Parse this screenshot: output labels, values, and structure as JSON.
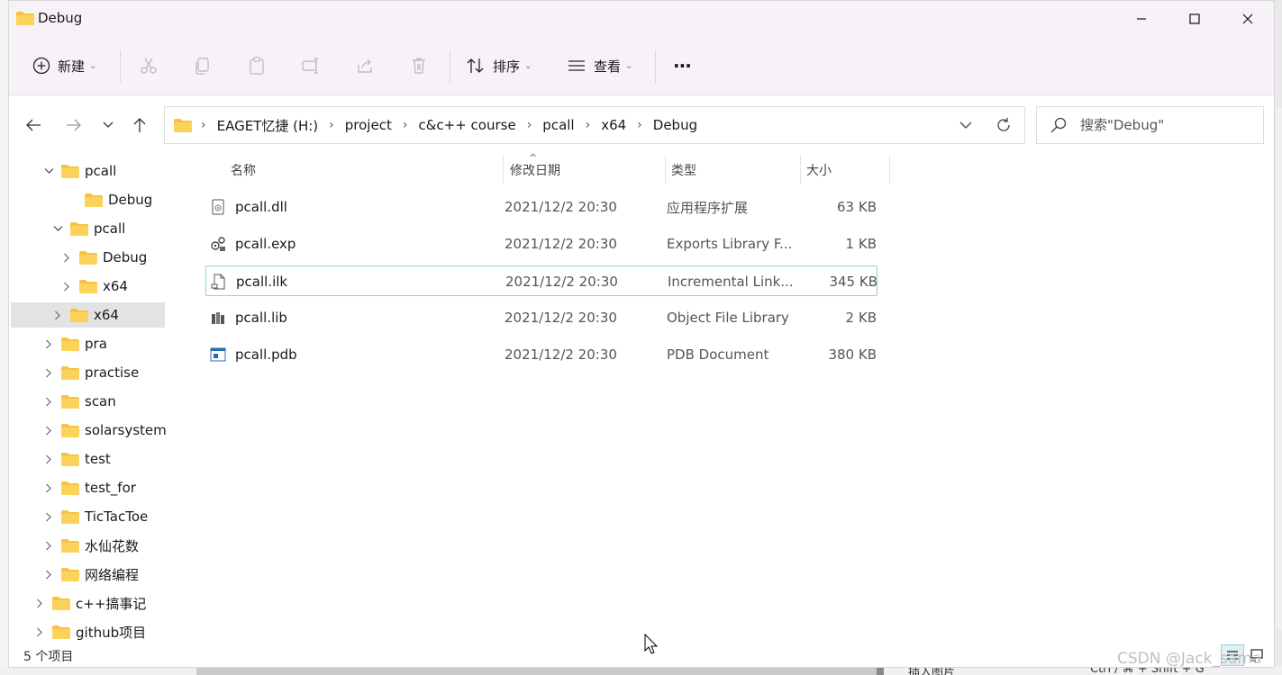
{
  "window": {
    "title": "Debug"
  },
  "toolbar": {
    "new_label": "新建",
    "sort_label": "排序",
    "view_label": "查看",
    "more_label": "···"
  },
  "address": {
    "crumbs": [
      "EAGET忆捷 (H:)",
      "project",
      "c&c++ course",
      "pcall",
      "x64",
      "Debug"
    ]
  },
  "search": {
    "placeholder": "搜索\"Debug\""
  },
  "sidebar": {
    "items": [
      {
        "label": "pcall",
        "chevron": "down"
      },
      {
        "label": "Debug",
        "chevron": ""
      },
      {
        "label": "pcall",
        "chevron": "down"
      },
      {
        "label": "Debug",
        "chevron": "right"
      },
      {
        "label": "x64",
        "chevron": "right"
      },
      {
        "label": "x64",
        "chevron": "right",
        "selected": true
      },
      {
        "label": "pra",
        "chevron": "right"
      },
      {
        "label": "practise",
        "chevron": "right"
      },
      {
        "label": "scan",
        "chevron": "right"
      },
      {
        "label": "solarsystem",
        "chevron": "right"
      },
      {
        "label": "test",
        "chevron": "right"
      },
      {
        "label": "test_for",
        "chevron": "right"
      },
      {
        "label": "TicTacToe",
        "chevron": "right"
      },
      {
        "label": "水仙花数",
        "chevron": "right"
      },
      {
        "label": "网络编程",
        "chevron": "right"
      },
      {
        "label": "c++搞事记",
        "chevron": "right"
      },
      {
        "label": "github项目",
        "chevron": "right"
      }
    ]
  },
  "columns": {
    "name": "名称",
    "date": "修改日期",
    "type": "类型",
    "size": "大小"
  },
  "files": [
    {
      "name": "pcall.dll",
      "date": "2021/12/2 20:30",
      "type": "应用程序扩展",
      "size": "63 KB",
      "icon": "dll-file-icon"
    },
    {
      "name": "pcall.exp",
      "date": "2021/12/2 20:30",
      "type": "Exports Library F...",
      "size": "1 KB",
      "icon": "exp-file-icon"
    },
    {
      "name": "pcall.ilk",
      "date": "2021/12/2 20:30",
      "type": "Incremental Link...",
      "size": "345 KB",
      "icon": "ilk-file-icon"
    },
    {
      "name": "pcall.lib",
      "date": "2021/12/2 20:30",
      "type": "Object File Library",
      "size": "2 KB",
      "icon": "lib-file-icon"
    },
    {
      "name": "pcall.pdb",
      "date": "2021/12/2 20:30",
      "type": "PDB Document",
      "size": "380 KB",
      "icon": "pdb-file-icon"
    }
  ],
  "status": {
    "count": "5 个项目"
  },
  "watermark": "CSDN @Jack_sama",
  "background": {
    "bottom_text_1": "插入图片",
    "bottom_text_2": "Ctrl / ⌘ + Shift + G"
  },
  "colors": {
    "folder": "#f8c33c",
    "toolbar_bg": "#f7f1f8",
    "focus_border": "#8ad4d6"
  }
}
